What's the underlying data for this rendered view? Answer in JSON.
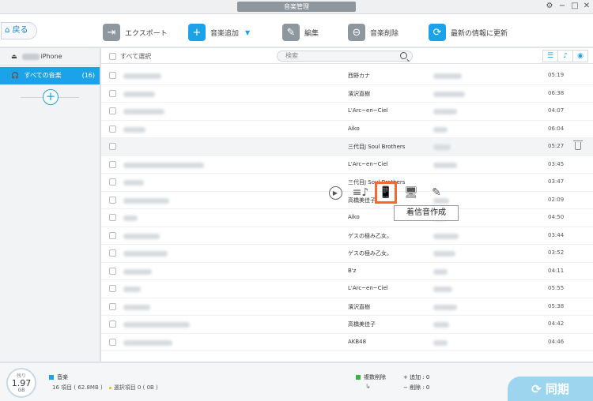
{
  "window": {
    "title": "音楽管理"
  },
  "toolbar": {
    "back_label": "戻る",
    "export_label": "エクスポート",
    "add_label": "音楽追加",
    "edit_label": "編集",
    "delete_label": "音楽削除",
    "refresh_label": "最新の情報に更新"
  },
  "sidebar": {
    "device_name": "iPhone",
    "nav": {
      "label": "すべての音楽",
      "count": "(16)"
    }
  },
  "list": {
    "select_all": "すべて選択",
    "search_placeholder": "検索",
    "rows": [
      {
        "artist": "西野カナ",
        "duration": "05:19"
      },
      {
        "artist": "濱沢直樹",
        "duration": "06:38"
      },
      {
        "artist": "L'Arc~en~Ciel",
        "duration": "04:07"
      },
      {
        "artist": "Aiko",
        "duration": "06:04"
      },
      {
        "artist": "三代目J Soul Brothers",
        "duration": "05:27"
      },
      {
        "artist": "L'Arc~en~Ciel",
        "duration": "03:45"
      },
      {
        "artist": "三代目J Soul Brothers",
        "duration": "03:47"
      },
      {
        "artist": "高橋美佳子",
        "duration": "02:09"
      },
      {
        "artist": "Aiko",
        "duration": "04:50"
      },
      {
        "artist": "ゲスの極み乙女。",
        "duration": "03:44"
      },
      {
        "artist": "ゲスの極み乙女。",
        "duration": "03:52"
      },
      {
        "artist": "B'z",
        "duration": "04:11"
      },
      {
        "artist": "L'Arc~en~Ciel",
        "duration": "05:55"
      },
      {
        "artist": "濱沢直樹",
        "duration": "05:38"
      },
      {
        "artist": "高橋美佳子",
        "duration": "04:42"
      },
      {
        "artist": "AKB48",
        "duration": "04:46"
      }
    ]
  },
  "tooltip": "着信音作成",
  "footer": {
    "storage_label": "残り",
    "storage_value": "1.97",
    "storage_unit": "GB",
    "music_label": "音楽",
    "items_info": "16 項目 ( 62.8MB )",
    "selected_info": "選択項目 0 ( 0B )",
    "duplicate_label": "複数削除",
    "add_label": "+ 追加 : 0",
    "delete_label": "− 削除 : 0",
    "sync_label": "同期"
  },
  "colors": {
    "accent": "#1aa3e8",
    "highlight": "#f36a2e",
    "sync_button": "#9dd5ef"
  }
}
